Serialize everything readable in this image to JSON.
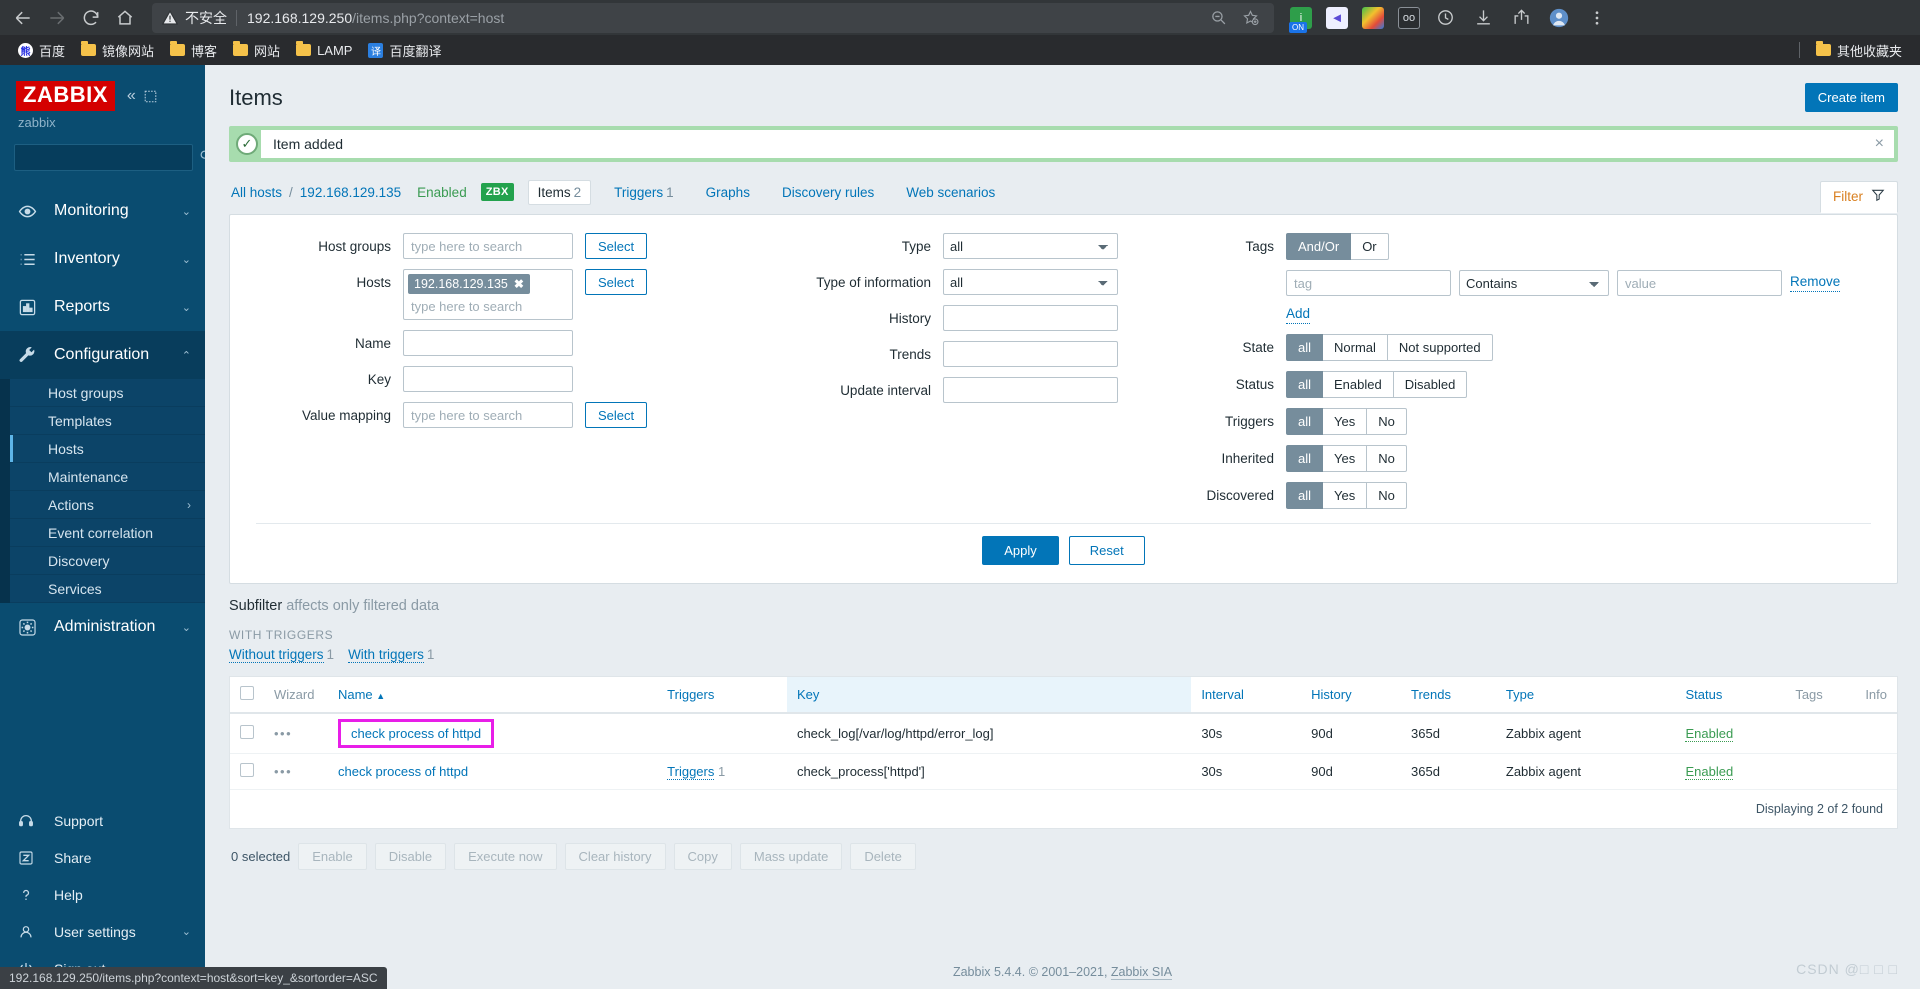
{
  "browser": {
    "back_icon": "back-arrow-icon",
    "forward_icon": "forward-arrow-icon",
    "reload_icon": "reload-icon",
    "home_icon": "home-icon",
    "security_label": "不安全",
    "url_host": "192.168.129.250",
    "url_path": "/items.php?context=host",
    "zoom_out_icon": "zoom-out-icon",
    "bookmark_star_icon": "star-add-icon",
    "extensions": [
      "ON",
      "kugou-icon",
      "idm-icon",
      "goo-icon"
    ],
    "history_icon": "history-icon",
    "download_icon": "download-icon",
    "share_icon": "share-icon",
    "profile_icon": "profile-avatar",
    "menu_icon": "more-menu-icon",
    "bookmarks": [
      {
        "label": "百度",
        "icon": "baidu-icon"
      },
      {
        "label": "镜像网站",
        "icon": "folder-icon"
      },
      {
        "label": "博客",
        "icon": "folder-icon"
      },
      {
        "label": "网站",
        "icon": "folder-icon"
      },
      {
        "label": "LAMP",
        "icon": "folder-icon"
      },
      {
        "label": "百度翻译",
        "icon": "fanyi-icon"
      }
    ],
    "other_bookmarks": {
      "label": "其他收藏夹",
      "icon": "folder-icon"
    }
  },
  "sidebar": {
    "logo": "ZABBIX",
    "server": "zabbix",
    "search_placeholder": "",
    "search_value": "",
    "nav": [
      {
        "label": "Monitoring",
        "icon": "eye-icon",
        "chevron": "⌄"
      },
      {
        "label": "Inventory",
        "icon": "list-icon",
        "chevron": "⌄"
      },
      {
        "label": "Reports",
        "icon": "bar-chart-icon",
        "chevron": "⌄"
      },
      {
        "label": "Configuration",
        "icon": "wrench-icon",
        "chevron": "⌃",
        "active": true
      },
      {
        "label": "Administration",
        "icon": "gear-icon",
        "chevron": "⌄"
      }
    ],
    "config_subitems": [
      {
        "label": "Host groups"
      },
      {
        "label": "Templates"
      },
      {
        "label": "Hosts",
        "active": true
      },
      {
        "label": "Maintenance"
      },
      {
        "label": "Actions",
        "chevron": "›"
      },
      {
        "label": "Event correlation"
      },
      {
        "label": "Discovery"
      },
      {
        "label": "Services"
      }
    ],
    "bottom": [
      {
        "label": "Support",
        "icon": "headset-icon"
      },
      {
        "label": "Share",
        "icon": "share-z-icon"
      },
      {
        "label": "Help",
        "icon": "question-icon"
      },
      {
        "label": "User settings",
        "icon": "user-icon",
        "chevron": "⌄"
      },
      {
        "label": "Sign out",
        "icon": "power-icon"
      }
    ]
  },
  "header": {
    "title": "Items",
    "create_button": "Create item"
  },
  "message": {
    "text": "Item added",
    "ok_icon": "check-icon",
    "close_icon": "close-icon"
  },
  "breadcrumb": {
    "all_hosts": "All hosts",
    "separator": "/",
    "host": "192.168.129.135",
    "status": "Enabled",
    "agent_badge": "ZBX",
    "tabs": [
      {
        "label": "Items",
        "count": "2",
        "active": true
      },
      {
        "label": "Triggers",
        "count": "1",
        "active": false
      },
      {
        "label": "Graphs",
        "count": "",
        "active": false
      },
      {
        "label": "Discovery rules",
        "count": "",
        "active": false
      },
      {
        "label": "Web scenarios",
        "count": "",
        "active": false
      }
    ],
    "filter_tab": "Filter",
    "filter_icon": "funnel-icon"
  },
  "filter": {
    "host_groups": {
      "label": "Host groups",
      "placeholder": "type here to search",
      "value": "",
      "select": "Select"
    },
    "hosts": {
      "label": "Hosts",
      "chip": "192.168.129.135",
      "placeholder": "type here to search",
      "select": "Select"
    },
    "name": {
      "label": "Name",
      "value": ""
    },
    "key": {
      "label": "Key",
      "value": ""
    },
    "value_mapping": {
      "label": "Value mapping",
      "placeholder": "type here to search",
      "value": "",
      "select": "Select"
    },
    "type": {
      "label": "Type",
      "value": "all"
    },
    "type_of_information": {
      "label": "Type of information",
      "value": "all"
    },
    "history": {
      "label": "History",
      "value": ""
    },
    "trends": {
      "label": "Trends",
      "value": ""
    },
    "update_interval": {
      "label": "Update interval",
      "value": ""
    },
    "tags": {
      "label": "Tags",
      "modes": [
        "And/Or",
        "Or"
      ],
      "selected_mode": "And/Or",
      "tag_placeholder": "tag",
      "operator": "Contains",
      "value_placeholder": "value",
      "remove": "Remove",
      "add": "Add"
    },
    "state": {
      "label": "State",
      "options": [
        "all",
        "Normal",
        "Not supported"
      ],
      "selected": "all"
    },
    "status": {
      "label": "Status",
      "options": [
        "all",
        "Enabled",
        "Disabled"
      ],
      "selected": "all"
    },
    "triggers": {
      "label": "Triggers",
      "options": [
        "all",
        "Yes",
        "No"
      ],
      "selected": "all"
    },
    "inherited": {
      "label": "Inherited",
      "options": [
        "all",
        "Yes",
        "No"
      ],
      "selected": "all"
    },
    "discovered": {
      "label": "Discovered",
      "options": [
        "all",
        "Yes",
        "No"
      ],
      "selected": "all"
    },
    "apply": "Apply",
    "reset": "Reset"
  },
  "subfilter": {
    "title": "Subfilter",
    "subtitle": "affects only filtered data",
    "group_label": "WITH TRIGGERS",
    "links": [
      {
        "label": "Without triggers",
        "count": "1"
      },
      {
        "label": "With triggers",
        "count": "1"
      }
    ]
  },
  "table": {
    "columns": [
      "Wizard",
      "Name",
      "Triggers",
      "Key",
      "Interval",
      "History",
      "Trends",
      "Type",
      "Status",
      "Tags",
      "Info"
    ],
    "sort_column": "Name",
    "sort_arrow": "▲",
    "rows": [
      {
        "wizard": "•••",
        "name": "check process of httpd",
        "highlighted": true,
        "triggers": "",
        "triggers_count": "",
        "key": "check_log[/var/log/httpd/error_log]",
        "interval": "30s",
        "history": "90d",
        "trends": "365d",
        "type": "Zabbix agent",
        "status": "Enabled",
        "tags": "",
        "info": ""
      },
      {
        "wizard": "•••",
        "name": "check process of httpd",
        "highlighted": false,
        "triggers": "Triggers",
        "triggers_count": "1",
        "key": "check_process['httpd']",
        "interval": "30s",
        "history": "90d",
        "trends": "365d",
        "type": "Zabbix agent",
        "status": "Enabled",
        "tags": "",
        "info": ""
      }
    ],
    "displaying": "Displaying 2 of 2 found"
  },
  "actions": {
    "selected": "0 selected",
    "buttons": [
      "Enable",
      "Disable",
      "Execute now",
      "Clear history",
      "Copy",
      "Mass update",
      "Delete"
    ]
  },
  "footer": {
    "text_before": "Zabbix 5.4.4. © 2001–2021, ",
    "link": "Zabbix SIA",
    "watermark": "CSDN @□ □ □"
  },
  "statusbar": {
    "url": "192.168.129.250/items.php?context=host&sort=key_&sortorder=ASC"
  }
}
